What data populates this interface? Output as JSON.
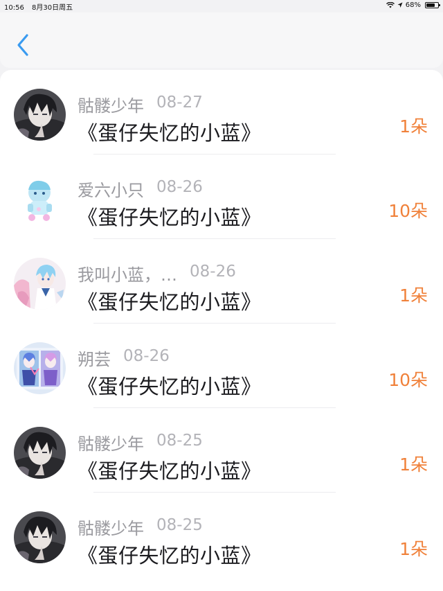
{
  "status_bar": {
    "time": "10:56",
    "date": "8月30日周五",
    "battery": "68%",
    "battery_level": 0.68
  },
  "nav": {
    "back_icon": "chevron-left-icon",
    "accent_color": "#3a9bf0"
  },
  "colors": {
    "count": "#f0813a",
    "name": "#9a9a9f",
    "date": "#b3b3b8",
    "title": "#1b1b1f"
  },
  "items": [
    {
      "name": "骷髅少年",
      "date": "08-27",
      "title": "《蛋仔失忆的小蓝》",
      "count": "1朵",
      "avatar": "dark-haired-boy-avatar"
    },
    {
      "name": "爱六小只",
      "date": "08-26",
      "title": "《蛋仔失忆的小蓝》",
      "count": "10朵",
      "avatar": "light-blue-character-avatar"
    },
    {
      "name": "我叫小蓝，…",
      "date": "08-26",
      "title": "《蛋仔失忆的小蓝》",
      "count": "1朵",
      "avatar": "blue-haired-boy-avatar"
    },
    {
      "name": "朔芸",
      "date": "08-26",
      "title": "《蛋仔失忆的小蓝》",
      "count": "10朵",
      "avatar": "two-characters-avatar"
    },
    {
      "name": "骷髅少年",
      "date": "08-25",
      "title": "《蛋仔失忆的小蓝》",
      "count": "1朵",
      "avatar": "dark-haired-boy-avatar"
    },
    {
      "name": "骷髅少年",
      "date": "08-25",
      "title": "《蛋仔失忆的小蓝》",
      "count": "1朵",
      "avatar": "dark-haired-boy-avatar"
    }
  ]
}
